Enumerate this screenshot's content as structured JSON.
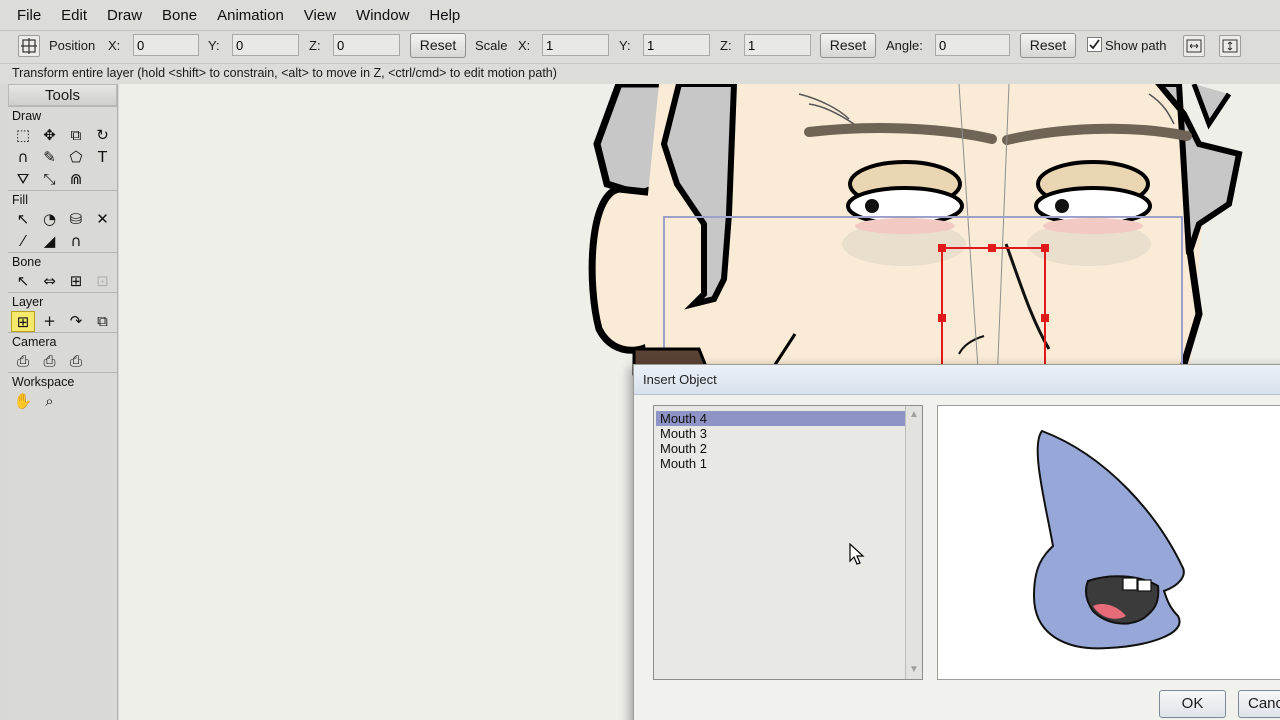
{
  "menu": {
    "items": [
      "File",
      "Edit",
      "Draw",
      "Bone",
      "Animation",
      "View",
      "Window",
      "Help"
    ]
  },
  "options": {
    "position_label": "Position",
    "x_label": "X:",
    "y_label": "Y:",
    "z_label": "Z:",
    "position_x": "0",
    "position_y": "0",
    "position_z": "0",
    "reset_label": "Reset",
    "scale_label": "Scale",
    "scale_x": "1",
    "scale_y": "1",
    "scale_z": "1",
    "angle_label": "Angle:",
    "angle": "0",
    "show_path_label": "Show path",
    "show_path_checked": true
  },
  "status": {
    "text": "Transform entire layer (hold <shift> to constrain, <alt> to move in Z, <ctrl/cmd> to edit motion path)"
  },
  "tools": {
    "title": "Tools",
    "sections": {
      "draw": "Draw",
      "fill": "Fill",
      "bone": "Bone",
      "layer": "Layer",
      "camera": "Camera",
      "workspace": "Workspace"
    }
  },
  "dialog": {
    "title": "Insert Object",
    "items": [
      "Mouth 4",
      "Mouth 3",
      "Mouth 2",
      "Mouth 1"
    ],
    "selected_index": 0,
    "ok_label": "OK",
    "cancel_label": "Canc"
  },
  "colors": {
    "selection": "#8e94c6",
    "mouth_fill": "#97a8d8",
    "skin": "#f9ebd5",
    "hair": "#c7c7c7",
    "active_tool": "#f6e86a",
    "motion_box": "#e01a1a"
  }
}
